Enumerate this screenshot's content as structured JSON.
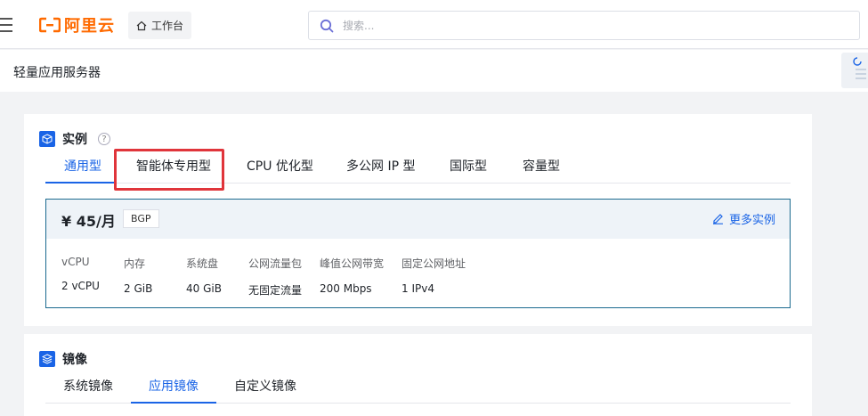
{
  "header": {
    "logo_text": "阿里云",
    "workbench_label": "工作台",
    "search_placeholder": "搜索...",
    "brand_color": "#ff6a00"
  },
  "subheader": {
    "title": "轻量应用服务器"
  },
  "instance_section": {
    "title": "实例",
    "help": "?",
    "tabs": [
      {
        "label": "通用型",
        "active": true
      },
      {
        "label": "智能体专用型",
        "active": false,
        "highlighted": true
      },
      {
        "label": "CPU 优化型",
        "active": false
      },
      {
        "label": "多公网 IP 型",
        "active": false
      },
      {
        "label": "国际型",
        "active": false
      },
      {
        "label": "容量型",
        "active": false
      }
    ],
    "plan": {
      "price": "¥ 45/月",
      "line_type": "BGP",
      "more_label": "更多实例",
      "specs": [
        {
          "key": "vCPU",
          "value": "2 vCPU"
        },
        {
          "key": "内存",
          "value": "2 GiB"
        },
        {
          "key": "系统盘",
          "value": "40 GiB"
        },
        {
          "key": "公网流量包",
          "value": "无固定流量"
        },
        {
          "key": "峰值公网带宽",
          "value": "200 Mbps"
        },
        {
          "key": "固定公网地址",
          "value": "1 IPv4"
        }
      ]
    }
  },
  "image_section": {
    "title": "镜像",
    "tabs": [
      {
        "label": "系统镜像",
        "active": false
      },
      {
        "label": "应用镜像",
        "active": true
      },
      {
        "label": "自定义镜像",
        "active": false
      }
    ]
  },
  "colors": {
    "accent": "#1a64e6",
    "highlight": "#e0353b",
    "plan_border": "#1b6a8f"
  },
  "icons": [
    "menu-icon",
    "aliyun-logo-icon",
    "home-icon",
    "search-icon",
    "cube-icon",
    "help-icon",
    "edit-icon",
    "layers-icon"
  ]
}
